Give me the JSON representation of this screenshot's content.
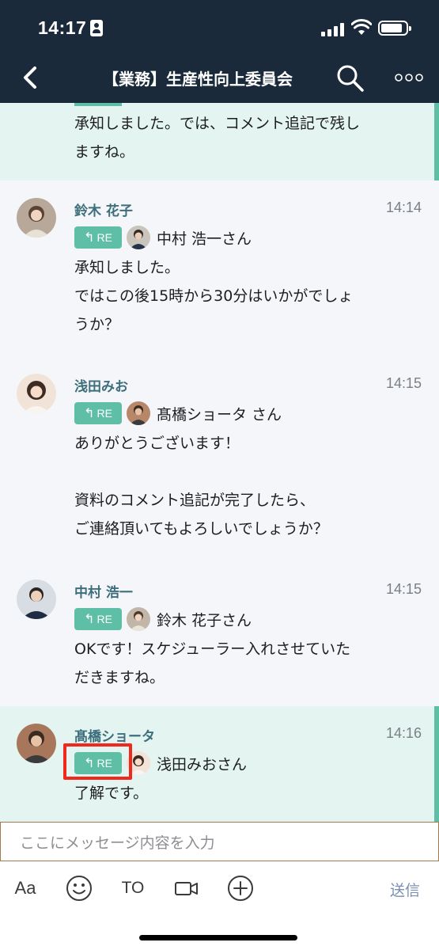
{
  "status": {
    "time": "14:17"
  },
  "header": {
    "title": "【業務】生産性向上委員会"
  },
  "colors": {
    "header_bg": "#1b2a3a",
    "accent": "#5fbfa6",
    "sender_name": "#3d6e7c",
    "highlight_bg": "#e3f4f1",
    "annotation_box": "#ef2a1d"
  },
  "icons": {
    "back": "chevron-left-icon",
    "search": "search-icon",
    "more": "more-horizontal-icon"
  },
  "messages": [
    {
      "text": "承知しました。では、コメント追記で残し\nますね。"
    },
    {
      "sender": "鈴木 花子",
      "time": "14:14",
      "re_label": "RE",
      "reply_to": "中村 浩一さん",
      "text": "承知しました。\nではこの後15時から30分はいかがでしょ\nうか？"
    },
    {
      "sender": "浅田みお",
      "time": "14:15",
      "re_label": "RE",
      "reply_to": "髙橋ショータ さん",
      "text": "ありがとうございます！\n\n資料のコメント追記が完了したら、\nご連絡頂いてもよろしいでしょうか？"
    },
    {
      "sender": "中村 浩一",
      "time": "14:15",
      "re_label": "RE",
      "reply_to": "鈴木 花子さん",
      "text": "OKです！スケジューラー入れさせていた\nだきますね。"
    },
    {
      "sender": "髙橋ショータ",
      "time": "14:16",
      "re_label": "RE",
      "reply_to": "浅田みおさん",
      "text": "了解です。"
    }
  ],
  "composer": {
    "placeholder": "ここにメッセージ内容を入力",
    "tools": {
      "font": "Aa",
      "to": "TO",
      "send": "送信"
    }
  }
}
